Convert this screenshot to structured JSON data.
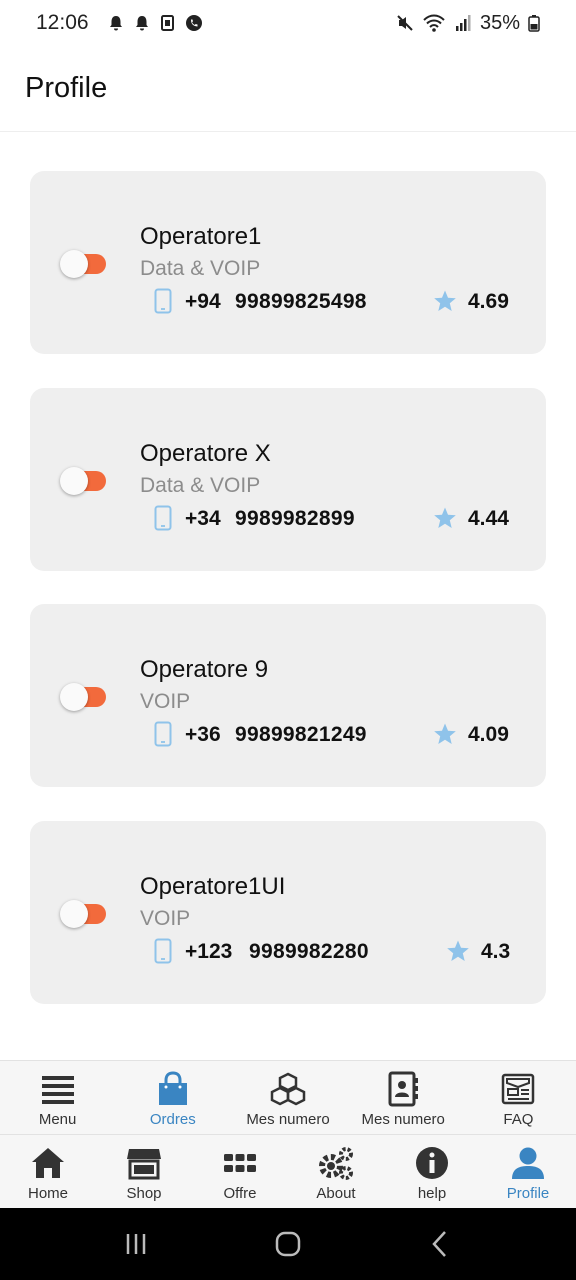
{
  "status_bar": {
    "time": "12:06",
    "battery": "35%"
  },
  "header": {
    "title": "Profile"
  },
  "operators": [
    {
      "name": "Operatore1",
      "type": "Data & VOIP",
      "code": "+94",
      "number": "99899825498",
      "rating": "4.69"
    },
    {
      "name": "Operatore X",
      "type": "Data & VOIP",
      "code": "+34",
      "number": "9989982899",
      "rating": "4.44"
    },
    {
      "name": "Operatore 9",
      "type": "VOIP",
      "code": "+36",
      "number": "99899821249",
      "rating": "4.09"
    },
    {
      "name": "Operatore1UI",
      "type": "VOIP",
      "code": "+123",
      "number": "9989982280",
      "rating": "4.3"
    }
  ],
  "nav_secondary": [
    {
      "label": "Menu",
      "icon": "hamburger-icon"
    },
    {
      "label": "Ordres",
      "icon": "shopping-bag-icon",
      "active": true
    },
    {
      "label": "Mes numero",
      "icon": "cubes-icon"
    },
    {
      "label": "Mes numero",
      "icon": "address-book-icon"
    },
    {
      "label": "FAQ",
      "icon": "newspaper-icon"
    }
  ],
  "nav_primary": [
    {
      "label": "Home",
      "icon": "home-icon"
    },
    {
      "label": "Shop",
      "icon": "store-icon"
    },
    {
      "label": "Offre",
      "icon": "grid-icon"
    },
    {
      "label": "About",
      "icon": "gears-icon"
    },
    {
      "label": "help",
      "icon": "info-icon"
    },
    {
      "label": "Profile",
      "icon": "user-icon",
      "active": true
    }
  ],
  "colors": {
    "accent": "#3a85c2",
    "toggle": "#f26a3c",
    "card": "#efefef",
    "star": "#8fc3ea"
  }
}
